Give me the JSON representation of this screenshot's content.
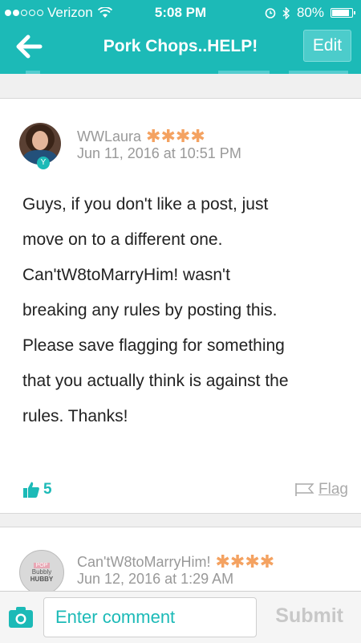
{
  "status_bar": {
    "carrier": "Verizon",
    "time": "5:08 PM",
    "battery": "80%",
    "battery_level": 0.8
  },
  "nav": {
    "title": "Pork Chops..HELP!",
    "edit_label": "Edit",
    "back_icon": "arrow-left-icon"
  },
  "posts": [
    {
      "username": "WWLaura",
      "stars": "✱✱✱✱",
      "timestamp": "Jun 11, 2016 at 10:51 PM",
      "body": [
        "Guys, if you don't like a post, just",
        "move on to a different one.",
        "Can'tW8toMarryHim! wasn't",
        "breaking any rules by posting this.",
        "Please save flagging for something",
        "that you actually think is against the",
        "rules. Thanks!"
      ],
      "likes": "5",
      "flag_label": "Flag"
    },
    {
      "username": "Can'tW8toMarryHim!",
      "stars": "✱✱✱✱",
      "timestamp": "Jun 12, 2016 at 1:29 AM",
      "avatar_text": [
        "POP",
        "Bubbly",
        "HUBBY"
      ]
    }
  ],
  "comment_bar": {
    "placeholder": "Enter comment",
    "submit_label": "Submit"
  },
  "colors": {
    "accent": "#1cbab7",
    "star": "#f4a261"
  }
}
